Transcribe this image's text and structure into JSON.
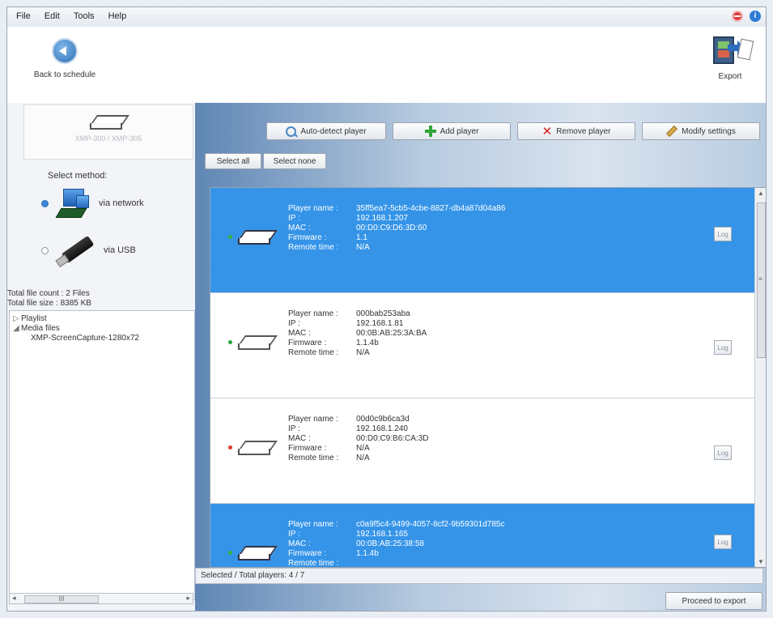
{
  "menu": [
    "File",
    "Edit",
    "Tools",
    "Help"
  ],
  "toolbar": {
    "back_label": "Back to schedule",
    "export_label": "Export"
  },
  "device": {
    "model": "XMP-300 / XMP-305"
  },
  "select_method": {
    "title": "Select method:",
    "options": [
      {
        "label": "via network",
        "selected": true
      },
      {
        "label": "via USB",
        "selected": false
      }
    ]
  },
  "totals": {
    "count": "Total file count : 2 Files",
    "size": "Total file size : 8385 KB"
  },
  "tree": {
    "playlist": "Playlist",
    "media": "Media files",
    "media_child": "XMP-ScreenCapture-1280x72"
  },
  "actions": {
    "auto_detect": "Auto-detect player",
    "add": "Add player",
    "remove": "Remove player",
    "modify": "Modify settings",
    "select_all": "Select all",
    "select_none": "Select none"
  },
  "labels": {
    "name": "Player name :",
    "ip": "IP :",
    "mac": "MAC :",
    "firmware": "Firmware :",
    "remote": "Remote time :",
    "log": "Log"
  },
  "players": [
    {
      "selected": true,
      "status": "green",
      "name": "35ff5ea7-5cb5-4cbe-8827-db4a87d04a86",
      "ip": "192.168.1.207",
      "mac": "00:D0:C9:D6:3D:60",
      "firmware": "1.1",
      "remote": "N/A"
    },
    {
      "selected": false,
      "status": "green",
      "name": "000bab253aba",
      "ip": "192.168.1.81",
      "mac": "00:0B:AB:25:3A:BA",
      "firmware": "1.1.4b",
      "remote": "N/A"
    },
    {
      "selected": false,
      "status": "red",
      "name": "00d0c9b6ca3d",
      "ip": "192.168.1.240",
      "mac": "00:D0:C9:B6:CA:3D",
      "firmware": "N/A",
      "remote": "N/A"
    },
    {
      "selected": true,
      "status": "green",
      "name": "c0a9f5c4-9499-4057-8cf2-9b59301d785c",
      "ip": "192.168.1.165",
      "mac": "00:0B:AB:25:38:58",
      "firmware": "1.1.4b",
      "remote": ""
    }
  ],
  "status_text": "Selected / Total players: 4 / 7",
  "proceed_label": "Proceed to export",
  "colors": {
    "selection": "#3594e8",
    "online": "#2aa637",
    "offline": "#e03a2a"
  }
}
